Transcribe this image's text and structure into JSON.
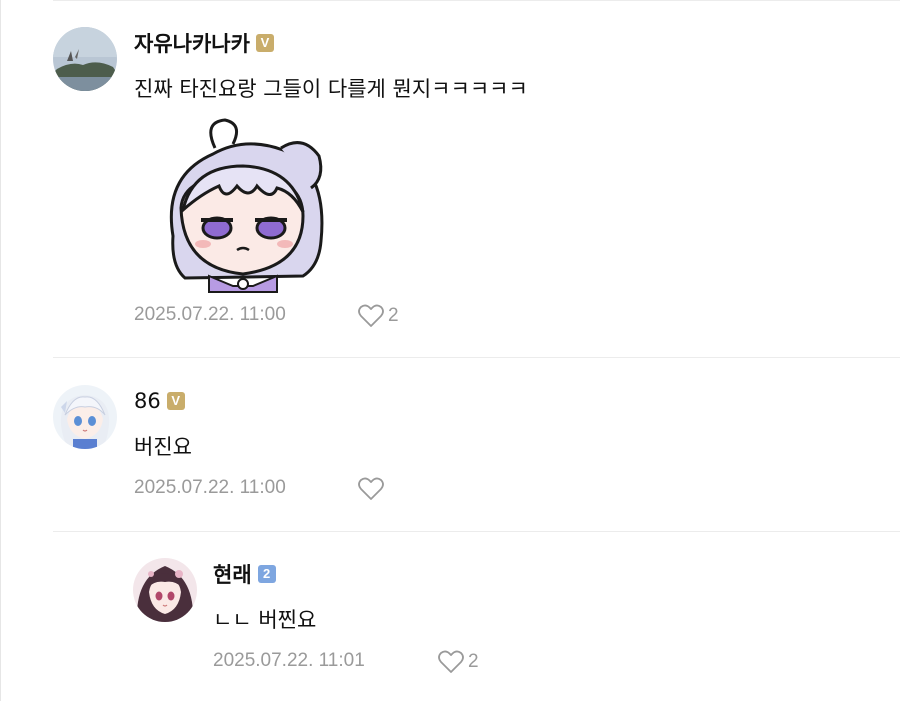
{
  "comments": [
    {
      "author": "자유나카나카",
      "badge": "V",
      "text": "진짜 타진요랑 그들이 다를게 뭔지ㅋㅋㅋㅋㅋ",
      "timestamp": "2025.07.22. 11:00",
      "likes": "2",
      "has_sticker": true
    },
    {
      "author": "86",
      "badge": "V",
      "text": "버진요",
      "timestamp": "2025.07.22. 11:00",
      "likes": ""
    },
    {
      "author": "현래",
      "badge": "2",
      "text": "ㄴㄴ 버찐요",
      "timestamp": "2025.07.22. 11:01",
      "likes": "2",
      "is_reply": true
    }
  ],
  "colors": {
    "badge_gold": "#c9ad6b",
    "badge_blue": "#7ea6e0",
    "meta_gray": "#9a9a9a",
    "divider": "#ececec"
  },
  "icons": {
    "like": "heart-outline-icon"
  }
}
